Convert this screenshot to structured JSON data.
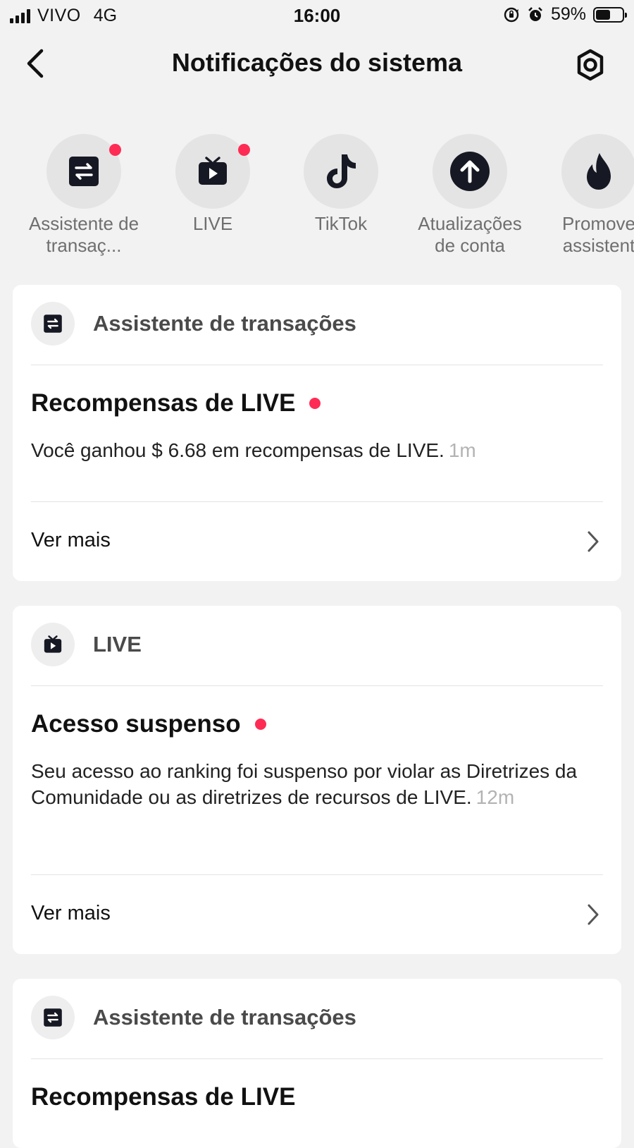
{
  "status_bar": {
    "carrier": "VIVO",
    "network": "4G",
    "time": "16:00",
    "battery_percent": "59%",
    "battery_level": 0.59
  },
  "header": {
    "title": "Notificações do sistema",
    "back_icon": "chevron-left-icon",
    "settings_icon": "gear-icon"
  },
  "categories": [
    {
      "label": "Assistente de transaç...",
      "icon": "exchange-icon",
      "unread": true
    },
    {
      "label": "LIVE",
      "icon": "tv-play-icon",
      "unread": true
    },
    {
      "label": "TikTok",
      "icon": "tiktok-icon",
      "unread": false
    },
    {
      "label": "Atualizações de conta",
      "icon": "arrow-up-circle-icon",
      "unread": false
    },
    {
      "label": "Promove assistent",
      "icon": "flame-icon",
      "unread": false
    }
  ],
  "cards": [
    {
      "source": "Assistente de transações",
      "title": "Recompensas de LIVE",
      "body": "Você ganhou $ 6.68 em recompensas de LIVE.",
      "time": "1m",
      "see_more": "Ver mais"
    },
    {
      "source": "LIVE",
      "title": "Acesso suspenso",
      "body": "Seu acesso ao ranking foi suspenso por violar as Diretrizes da Comunidade ou as diretrizes de recursos de LIVE.",
      "time": "12m",
      "see_more": "Ver mais"
    },
    {
      "source": "Assistente de transações",
      "title": "Recompensas de LIVE"
    }
  ],
  "colors": {
    "accent_red": "#fe2c55",
    "background": "#f2f2f2",
    "card": "#ffffff"
  }
}
